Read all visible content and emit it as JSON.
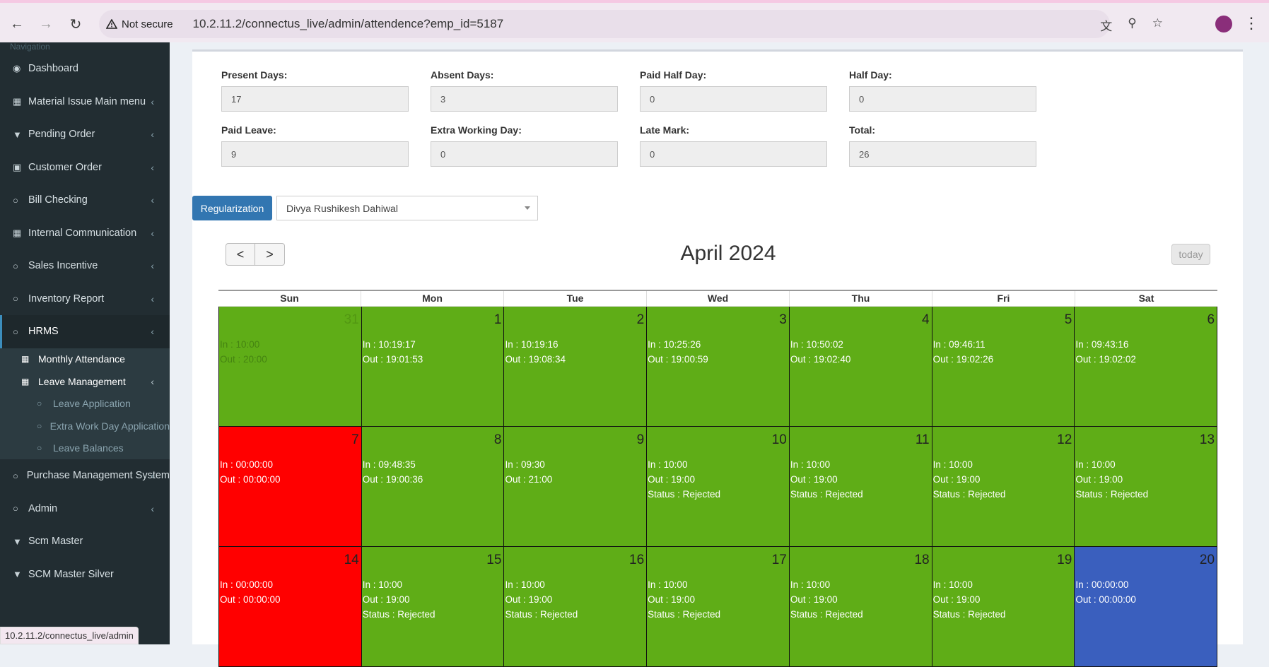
{
  "browser": {
    "security_label": "Not secure",
    "url": "10.2.11.2/connectus_live/admin/attendence?emp_id=5187",
    "status_url": "10.2.11.2/connectus_live/admin"
  },
  "sidebar": {
    "header": "Navigation",
    "items": [
      {
        "label": "Dashboard",
        "icon": "dashboard-icon"
      },
      {
        "label": "Material Issue Main menu",
        "icon": "table-icon"
      },
      {
        "label": "Pending Order",
        "icon": "filter-icon"
      },
      {
        "label": "Customer Order",
        "icon": "money-icon"
      },
      {
        "label": "Bill Checking",
        "icon": "circle-icon"
      },
      {
        "label": "Internal Communication",
        "icon": "table-icon"
      },
      {
        "label": "Sales Incentive",
        "icon": "circle-icon"
      },
      {
        "label": "Inventory Report",
        "icon": "circle-icon"
      },
      {
        "label": "HRMS",
        "icon": "circle-icon"
      }
    ],
    "hrms_sub": {
      "monthly_attendance": "Monthly Attendance",
      "leave_management": "Leave Management",
      "leave_children": [
        "Leave Application",
        "Extra Work Day Application",
        "Leave Balances"
      ]
    },
    "bottom_items": [
      {
        "label": "Purchase Management System",
        "icon": "circle-icon"
      },
      {
        "label": "Admin",
        "icon": "circle-icon"
      },
      {
        "label": "Scm Master",
        "icon": "filter-icon"
      },
      {
        "label": "SCM Master Silver",
        "icon": "filter-icon"
      }
    ]
  },
  "summary": {
    "present_days": {
      "label": "Present Days:",
      "value": "17"
    },
    "absent_days": {
      "label": "Absent Days:",
      "value": "3"
    },
    "paid_half_day": {
      "label": "Paid Half Day:",
      "value": "0"
    },
    "half_day": {
      "label": "Half Day:",
      "value": "0"
    },
    "paid_leave": {
      "label": "Paid Leave:",
      "value": "9"
    },
    "extra_working_day": {
      "label": "Extra Working Day:",
      "value": "0"
    },
    "late_mark": {
      "label": "Late Mark:",
      "value": "0"
    },
    "total": {
      "label": "Total:",
      "value": "26"
    }
  },
  "controls": {
    "regularization_label": "Regularization",
    "employee_selected": "Divya Rushikesh Dahiwal"
  },
  "calendar": {
    "title": "April 2024",
    "prev": "<",
    "next": ">",
    "today_label": "today",
    "days_of_week": [
      "Sun",
      "Mon",
      "Tue",
      "Wed",
      "Thu",
      "Fri",
      "Sat"
    ],
    "colors": {
      "green": "#5fad17",
      "red": "#ff0000",
      "blue": "#3a5fbe"
    },
    "weeks": [
      [
        {
          "num": "31",
          "color": "green",
          "other": true,
          "lines": [
            "In : 10:00",
            "Out : 20:00"
          ]
        },
        {
          "num": "1",
          "color": "green",
          "lines": [
            "In : 10:19:17",
            "Out : 19:01:53"
          ]
        },
        {
          "num": "2",
          "color": "green",
          "lines": [
            "In : 10:19:16",
            "Out : 19:08:34"
          ]
        },
        {
          "num": "3",
          "color": "green",
          "lines": [
            "In : 10:25:26",
            "Out : 19:00:59"
          ]
        },
        {
          "num": "4",
          "color": "green",
          "lines": [
            "In : 10:50:02",
            "Out : 19:02:40"
          ]
        },
        {
          "num": "5",
          "color": "green",
          "lines": [
            "In : 09:46:11",
            "Out : 19:02:26"
          ]
        },
        {
          "num": "6",
          "color": "green",
          "lines": [
            "In : 09:43:16",
            "Out : 19:02:02"
          ]
        }
      ],
      [
        {
          "num": "7",
          "color": "red",
          "lines": [
            "In : 00:00:00",
            "Out : 00:00:00"
          ]
        },
        {
          "num": "8",
          "color": "green",
          "lines": [
            "In : 09:48:35",
            "Out : 19:00:36"
          ]
        },
        {
          "num": "9",
          "color": "green",
          "lines": [
            "In : 09:30",
            "Out : 21:00"
          ]
        },
        {
          "num": "10",
          "color": "green",
          "lines": [
            "In : 10:00",
            "Out : 19:00",
            "Status : Rejected"
          ]
        },
        {
          "num": "11",
          "color": "green",
          "lines": [
            "In : 10:00",
            "Out : 19:00",
            "Status : Rejected"
          ]
        },
        {
          "num": "12",
          "color": "green",
          "lines": [
            "In : 10:00",
            "Out : 19:00",
            "Status : Rejected"
          ]
        },
        {
          "num": "13",
          "color": "green",
          "lines": [
            "In : 10:00",
            "Out : 19:00",
            "Status : Rejected"
          ]
        }
      ],
      [
        {
          "num": "14",
          "color": "red",
          "lines": [
            "In : 00:00:00",
            "Out : 00:00:00"
          ]
        },
        {
          "num": "15",
          "color": "green",
          "lines": [
            "In : 10:00",
            "Out : 19:00",
            "Status : Rejected"
          ]
        },
        {
          "num": "16",
          "color": "green",
          "lines": [
            "In : 10:00",
            "Out : 19:00",
            "Status : Rejected"
          ]
        },
        {
          "num": "17",
          "color": "green",
          "lines": [
            "In : 10:00",
            "Out : 19:00",
            "Status : Rejected"
          ]
        },
        {
          "num": "18",
          "color": "green",
          "lines": [
            "In : 10:00",
            "Out : 19:00",
            "Status : Rejected"
          ]
        },
        {
          "num": "19",
          "color": "green",
          "lines": [
            "In : 10:00",
            "Out : 19:00",
            "Status : Rejected"
          ]
        },
        {
          "num": "20",
          "color": "blue",
          "lines": [
            "In : 00:00:00",
            "Out : 00:00:00"
          ]
        }
      ]
    ]
  }
}
